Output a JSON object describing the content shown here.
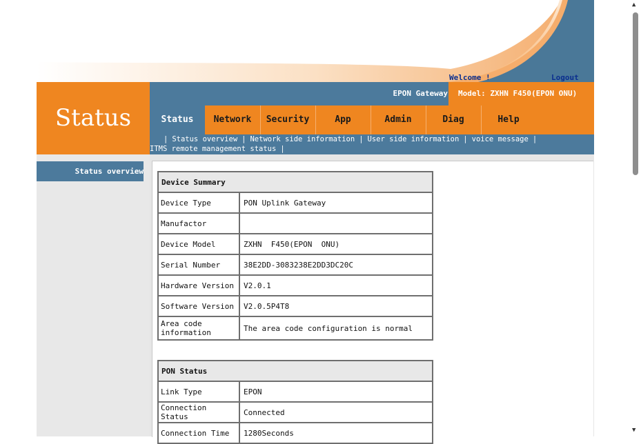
{
  "header": {
    "welcome": "Welcome !",
    "logout": "Logout",
    "gateway": "EPON Gateway",
    "model": "Model: ZXHN F450(EPON ONU)",
    "page_title": "Status"
  },
  "tabs": [
    {
      "label": "Status"
    },
    {
      "label": "Network"
    },
    {
      "label": "Security"
    },
    {
      "label": "App"
    },
    {
      "label": "Admin"
    },
    {
      "label": "Diag"
    },
    {
      "label": "Help"
    }
  ],
  "subnav": [
    {
      "label": "Status overview"
    },
    {
      "label": "Network side information"
    },
    {
      "label": "User side information"
    },
    {
      "label": "voice message"
    },
    {
      "label": "ITMS remote management status"
    }
  ],
  "sidebar": {
    "items": [
      {
        "label": "Status overview"
      }
    ]
  },
  "device_summary": {
    "title": "Device Summary",
    "rows": [
      {
        "key": "Device Type",
        "value": "PON Uplink Gateway"
      },
      {
        "key": "Manufactor",
        "value": ""
      },
      {
        "key": "Device Model",
        "value": "ZXHN  F450(EPON  ONU)"
      },
      {
        "key": "Serial Number",
        "value": "38E2DD-3083238E2DD3DC20C"
      },
      {
        "key": "Hardware Version",
        "value": "V2.0.1"
      },
      {
        "key": "Software Version",
        "value": "V2.0.5P4T8"
      },
      {
        "key": "Area code information",
        "value": "The area code configuration is normal"
      }
    ]
  },
  "pon_status": {
    "title": "PON Status",
    "rows": [
      {
        "key": "Link Type",
        "value": "EPON"
      },
      {
        "key": "Connection Status",
        "value": "Connected"
      },
      {
        "key": "Connection Time",
        "value": "1280Seconds"
      }
    ]
  },
  "colors": {
    "orange": "#ef8620",
    "steel_blue": "#4c7a9c",
    "link_blue": "#0b2f8f"
  }
}
